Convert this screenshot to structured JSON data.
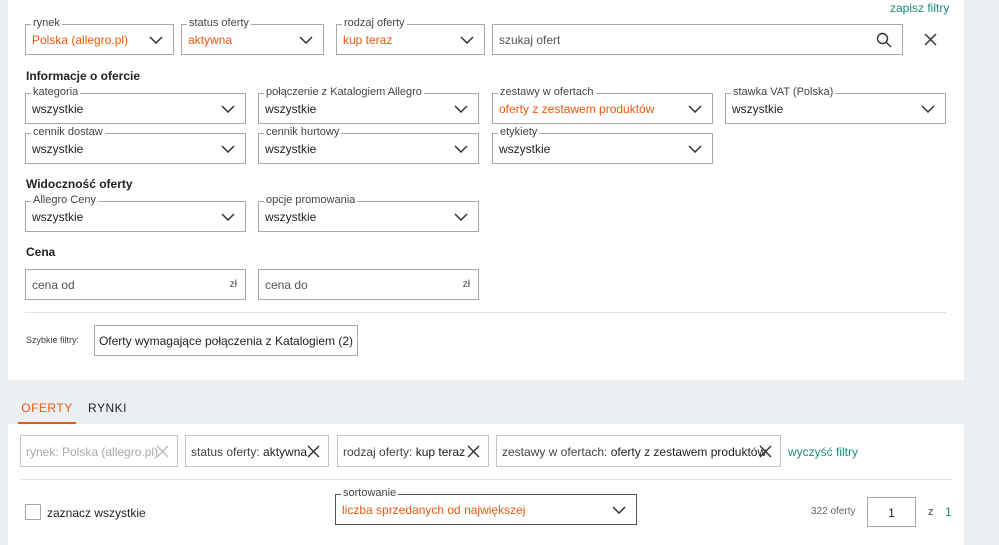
{
  "toolbar": {
    "save_filters": "zapisz filtry",
    "market": {
      "label": "rynek",
      "value": "Polska (allegro.pl)"
    },
    "status": {
      "label": "status oferty",
      "value": "aktywna"
    },
    "type": {
      "label": "rodzaj oferty",
      "value": "kup teraz"
    },
    "search_placeholder": "szukaj ofert"
  },
  "sections": {
    "info": "Informacje o ofercie",
    "visibility": "Widoczność oferty",
    "price": "Cena"
  },
  "filters": {
    "category": {
      "label": "kategoria",
      "value": "wszystkie"
    },
    "catalog": {
      "label": "połączenie z Katalogiem Allegro",
      "value": "wszystkie"
    },
    "bundles": {
      "label": "zestawy w ofertach",
      "value": "oferty z zestawem produktów"
    },
    "vat": {
      "label": "stawka VAT (Polska)",
      "value": "wszystkie"
    },
    "shipping": {
      "label": "cennik dostaw",
      "value": "wszystkie"
    },
    "wholesale": {
      "label": "cennik hurtowy",
      "value": "wszystkie"
    },
    "tags": {
      "label": "etykiety",
      "value": "wszystkie"
    },
    "allegro_prices": {
      "label": "Allegro Ceny",
      "value": "wszystkie"
    },
    "promo": {
      "label": "opcje promowania",
      "value": "wszystkie"
    }
  },
  "price": {
    "from_placeholder": "cena od",
    "to_placeholder": "cena do",
    "currency": "zł"
  },
  "quick_filters": {
    "label": "Szybkie filtry:",
    "button": "Oferty wymagające połączenia z Katalogiem (2)"
  },
  "tabs": [
    "OFERTY",
    "RYNKI"
  ],
  "chips": [
    {
      "key": "rynek:",
      "value": "Polska (allegro.pl)"
    },
    {
      "key": "status oferty:",
      "value": "aktywna"
    },
    {
      "key": "rodzaj oferty:",
      "value": "kup teraz"
    },
    {
      "key": "zestawy w ofertach:",
      "value": "oferty z zestawem produktów"
    }
  ],
  "clear_filters": "wyczyść filtry",
  "list": {
    "select_all": "zaznacz wszystkie",
    "sort_label": "sortowanie",
    "sort_value": "liczba sprzedanych od największej",
    "count": "322 oferty",
    "page": "1",
    "page_of": "z",
    "page_total": "1"
  },
  "colors": {
    "accent": "#e8590c",
    "link": "#1a8a78"
  }
}
